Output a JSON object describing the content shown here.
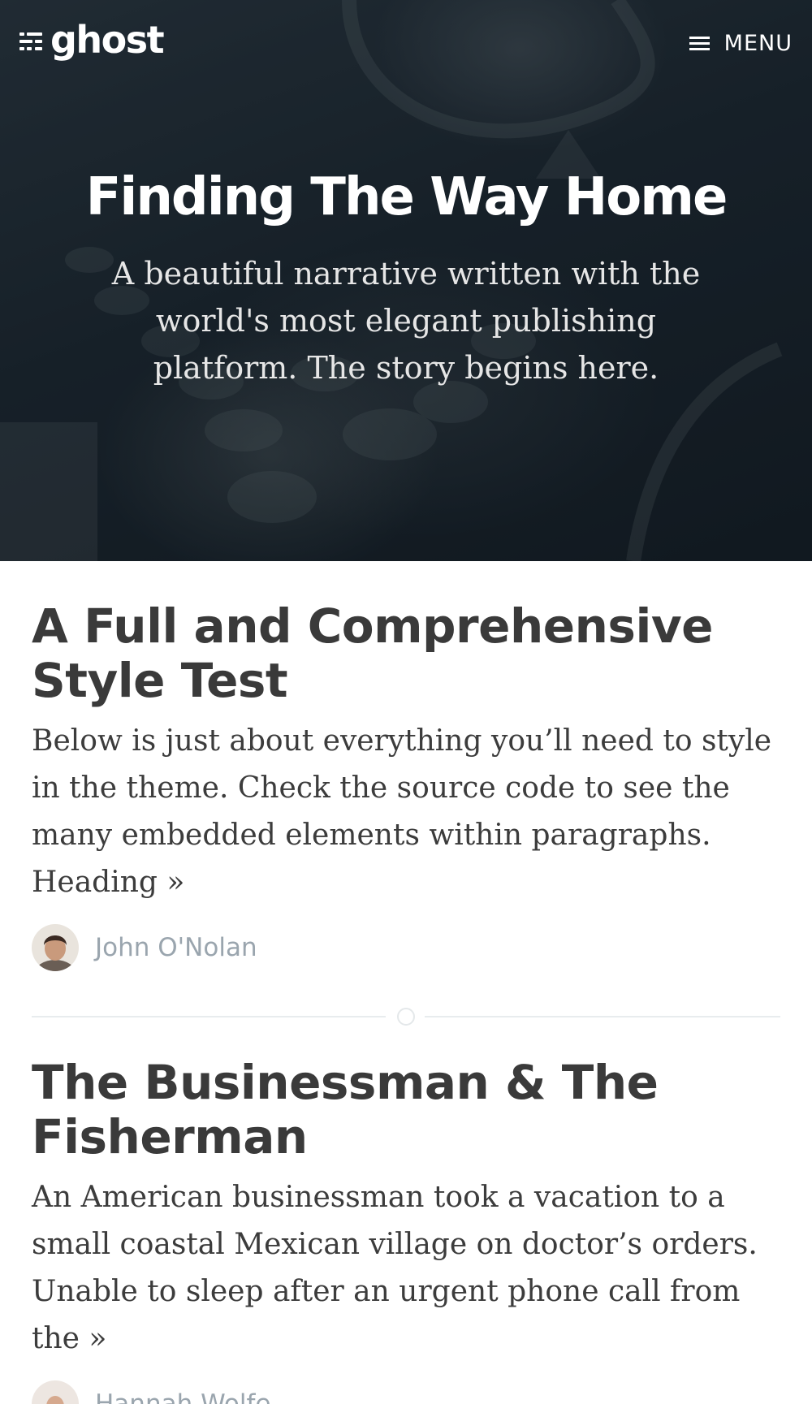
{
  "header": {
    "logo_text": "ghost",
    "logo_icon": "ghost-logo-icon",
    "menu_icon": "hamburger-icon",
    "menu_label": "MENU"
  },
  "hero": {
    "title": "Finding The Way Home",
    "description": "A beautiful narrative written with the world's most elegant publishing platform. The story begins here."
  },
  "posts": [
    {
      "title": "A Full and Comprehensive Style Test",
      "excerpt": "Below is just about everything you’ll need to style in the theme. Check the source code to see the many embedded elements within paragraphs. Heading",
      "read_more": "»",
      "author": "John O'Nolan"
    },
    {
      "title": "The Businessman & The Fisherman",
      "excerpt": "An American businessman took a vacation to a small coastal Mexican village on doctor’s orders. Unable to sleep after an urgent phone call from the",
      "read_more": "»",
      "author": "Hannah Wolfe"
    }
  ],
  "colors": {
    "hero_overlay": "#1c262e",
    "title_text": "#3a3a3a",
    "author_text": "#9aa5ae",
    "divider": "#e8ecee"
  }
}
